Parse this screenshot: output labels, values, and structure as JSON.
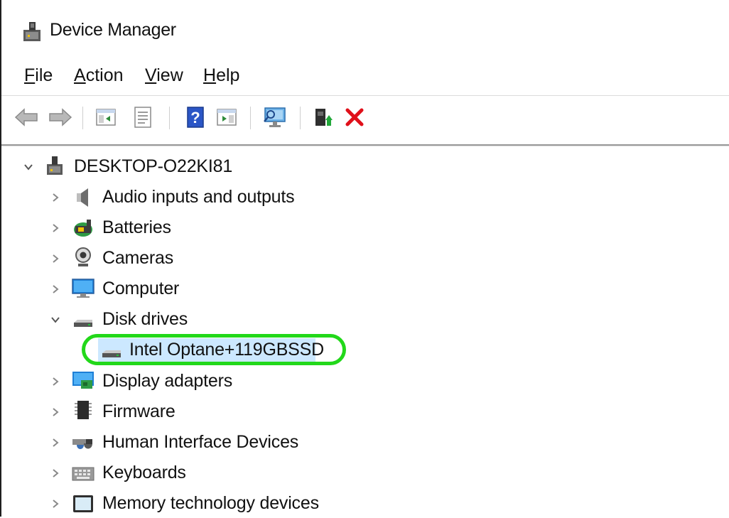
{
  "window": {
    "title": "Device Manager"
  },
  "menu": [
    {
      "label_u": "F",
      "label_rest": "ile"
    },
    {
      "label_u": "A",
      "label_rest": "ction"
    },
    {
      "label_u": "V",
      "label_rest": "iew"
    },
    {
      "label_u": "H",
      "label_rest": "elp"
    }
  ],
  "toolbar": {
    "buttons": [
      "back-icon",
      "forward-icon",
      "show-hide-console-tree-icon",
      "properties-icon",
      "help-icon",
      "show-action-pane-icon",
      "scan-hardware-icon",
      "update-driver-icon",
      "uninstall-device-icon"
    ]
  },
  "tree": {
    "root": "DESKTOP-O22KI81",
    "items": [
      {
        "label": "Audio inputs and outputs",
        "icon": "speaker-icon",
        "expanded": false
      },
      {
        "label": "Batteries",
        "icon": "battery-icon",
        "expanded": false
      },
      {
        "label": "Cameras",
        "icon": "camera-icon",
        "expanded": false
      },
      {
        "label": "Computer",
        "icon": "monitor-icon",
        "expanded": false
      },
      {
        "label": "Disk drives",
        "icon": "disk-drive-icon",
        "expanded": true,
        "children": [
          {
            "label": "Intel Optane+119GBSSD",
            "icon": "disk-drive-icon",
            "selected": true
          }
        ]
      },
      {
        "label": "Display adapters",
        "icon": "display-adapter-icon",
        "expanded": false
      },
      {
        "label": "Firmware",
        "icon": "firmware-chip-icon",
        "expanded": false
      },
      {
        "label": "Human Interface Devices",
        "icon": "hid-icon",
        "expanded": false
      },
      {
        "label": "Keyboards",
        "icon": "keyboard-icon",
        "expanded": false
      },
      {
        "label": "Memory technology devices",
        "icon": "memory-device-icon",
        "expanded": false
      }
    ]
  },
  "colors": {
    "highlight_ring": "#22d81a",
    "selection": "#cce8ff",
    "uninstall_red": "#e0101a"
  }
}
